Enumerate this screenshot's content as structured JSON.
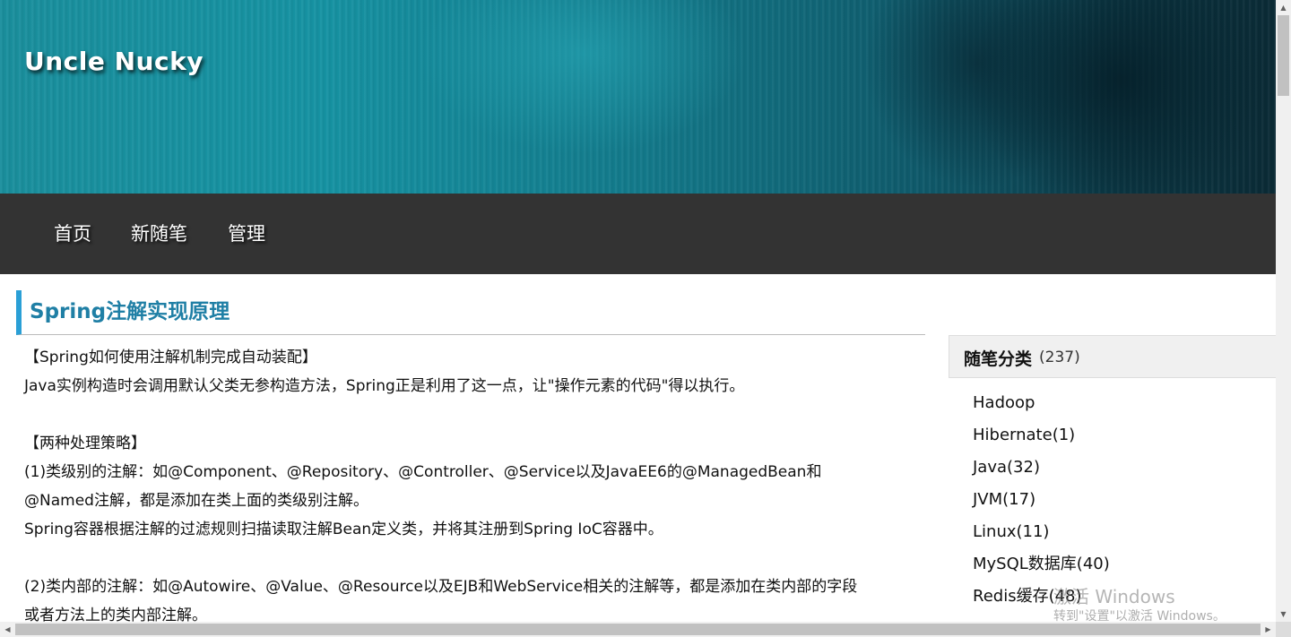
{
  "header": {
    "site_title": "Uncle Nucky"
  },
  "nav": {
    "items": [
      "首页",
      "新随笔",
      "管理"
    ]
  },
  "post": {
    "title": "Spring注解实现原理",
    "lines": [
      "【Spring如何使用注解机制完成自动装配】",
      "Java实例构造时会调用默认父类无参构造方法，Spring正是利用了这一点，让\"操作元素的代码\"得以执行。",
      "",
      "【两种处理策略】",
      "(1)类级别的注解：如@Component、@Repository、@Controller、@Service以及JavaEE6的@ManagedBean和",
      "@Named注解，都是添加在类上面的类级别注解。",
      "Spring容器根据注解的过滤规则扫描读取注解Bean定义类，并将其注册到Spring IoC容器中。",
      "",
      "(2)类内部的注解：如@Autowire、@Value、@Resource以及EJB和WebService相关的注解等，都是添加在类内部的字段",
      "或者方法上的类内部注解。"
    ]
  },
  "sidebar": {
    "heading": "随笔分类",
    "count": "(237)",
    "categories": [
      "Hadoop",
      "Hibernate(1)",
      "Java(32)",
      "JVM(17)",
      "Linux(11)",
      "MySQL数据库(40)",
      "Redis缓存(48)"
    ]
  },
  "watermark": {
    "line1": "激活 Windows",
    "line2": "转到\"设置\"以激活 Windows。"
  },
  "icons": {
    "scroll_up": "triangle-up-icon",
    "scroll_down": "triangle-down-icon",
    "scroll_left": "triangle-left-icon",
    "scroll_right": "triangle-right-icon"
  },
  "colors": {
    "nav_bg": "#333333",
    "title_accent": "#2a9fd6",
    "title_text": "#1f7fa5"
  }
}
